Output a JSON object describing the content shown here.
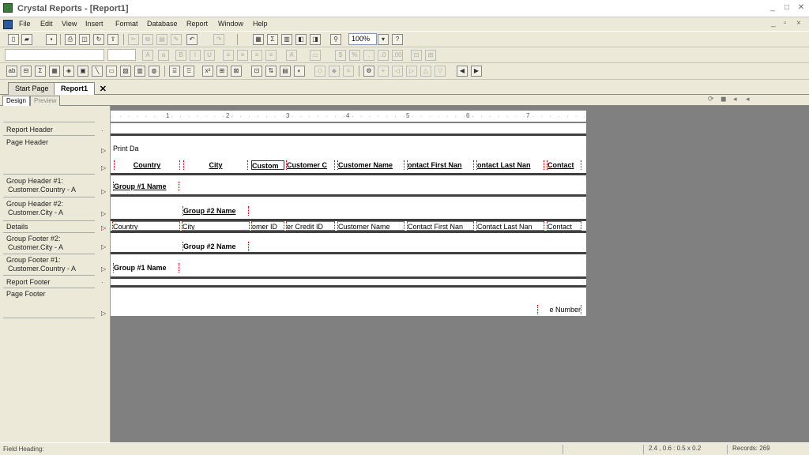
{
  "window": {
    "title": "Crystal Reports - [Report1]",
    "minimize": "_",
    "restore": "□",
    "close": "✕"
  },
  "menu": [
    "File",
    "Edit",
    "View",
    "Insert",
    "Format",
    "Database",
    "Report",
    "Window",
    "Help"
  ],
  "toolbar": {
    "zoom": "100%"
  },
  "tabs": {
    "start_page": "Start Page",
    "report": "Report1",
    "close": "✕"
  },
  "view_tabs": {
    "design": "Design",
    "preview": "Preview"
  },
  "ruler": {
    "marks": [
      "1",
      "2",
      "3",
      "4",
      "5",
      "6",
      "7"
    ]
  },
  "sections": [
    {
      "label": "Report Header"
    },
    {
      "label": "Page Header"
    },
    {
      "label": "Group Header #1:",
      "sub": "Customer.Country - A"
    },
    {
      "label": "Group Header #2:",
      "sub": "Customer.City - A"
    },
    {
      "label": "Details"
    },
    {
      "label": "Group Footer #2:",
      "sub": "Customer.City - A"
    },
    {
      "label": "Group Footer #1:",
      "sub": "Customer.Country - A"
    },
    {
      "label": "Report Footer"
    },
    {
      "label": "Page Footer"
    }
  ],
  "report": {
    "page_header": {
      "print_date": "Print Da",
      "columns": [
        "Country",
        "City",
        "Custom",
        "Customer C",
        "Customer Name",
        "ontact First Nan",
        "ontact Last Nan",
        "Contact"
      ]
    },
    "gh1": {
      "field": "Group #1 Name"
    },
    "gh2": {
      "field": "Group #2 Name"
    },
    "details": {
      "fields": [
        "Country",
        "City",
        "omer ID",
        "er Credit ID",
        "Customer Name",
        "Contact First Nan",
        "Contact Last Nan",
        "Contact"
      ]
    },
    "gf2": {
      "field": "Group #2 Name"
    },
    "gf1": {
      "field": "Group #1 Name"
    },
    "page_footer": {
      "page_number": "e Number"
    }
  },
  "status": {
    "left": "Field Heading:",
    "position": "2.4 , 0.6 : 0.5 x 0.2",
    "records": "Records: 269"
  },
  "colors": {
    "workspace": "#808080",
    "chrome": "#ece9d8",
    "divider": "#404040"
  }
}
